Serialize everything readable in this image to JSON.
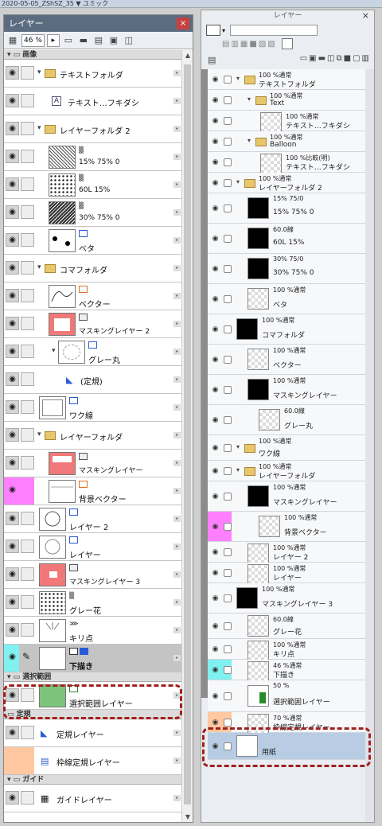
{
  "topbar": {
    "text": "2020-05-05_ZShSZ_35 ▼   ユミック"
  },
  "left": {
    "title": "レイヤー",
    "zoom": "46 %",
    "group_canvas": "画像",
    "group_selection": "選択範囲",
    "group_ruler": "定規",
    "group_guide": "ガイド",
    "rows": [
      {
        "name": "テキストフォルダ",
        "type": "folder"
      },
      {
        "name": "テキスト…フキダシ",
        "type": "text"
      },
      {
        "name": "レイヤーフォルダ 2",
        "type": "folder"
      },
      {
        "name": "15% 75% 0",
        "mode": "▒",
        "type": "tone"
      },
      {
        "name": "60L 15%",
        "mode": "▒",
        "type": "tone2"
      },
      {
        "name": "30% 75% 0",
        "mode": "▒",
        "type": "tone"
      },
      {
        "name": "ベタ",
        "type": "raster"
      },
      {
        "name": "コマフォルダ",
        "type": "folder"
      },
      {
        "name": "ベクター",
        "type": "vector"
      },
      {
        "name": "マスキングレイヤー 2",
        "type": "mask"
      },
      {
        "name": "グレー丸",
        "type": "raster"
      },
      {
        "name": "(定規)",
        "type": "ruler"
      },
      {
        "name": "ワク線",
        "type": "raster"
      },
      {
        "name": "レイヤーフォルダ",
        "type": "folder"
      },
      {
        "name": "マスキングレイヤー",
        "type": "mask"
      },
      {
        "name": "背景ベクター",
        "type": "vector"
      },
      {
        "name": "レイヤー 2",
        "type": "raster"
      },
      {
        "name": "レイヤー",
        "type": "raster"
      },
      {
        "name": "マスキングレイヤー 3",
        "type": "mask"
      },
      {
        "name": "グレー花",
        "type": "raster"
      },
      {
        "name": "キリ点",
        "type": "raster"
      },
      {
        "name": "下描き",
        "type": "draft"
      }
    ],
    "selection_layer": "選択範囲レイヤー",
    "ruler_layer": "定規レイヤー",
    "frame_ruler_layer": "枠線定規レイヤー",
    "guide_layer": "ガイドレイヤー"
  },
  "right": {
    "title": "レイヤー",
    "close": "×",
    "rows": [
      {
        "mode": "100 %通常",
        "name": "テキストフォルダ"
      },
      {
        "mode": "100 %通常",
        "name": "Text"
      },
      {
        "mode": "100 %通常",
        "name": "テキスト…フキダシ"
      },
      {
        "mode": "100 %通常",
        "name": "Balloon"
      },
      {
        "mode": "100 %比較(明)",
        "name": "テキスト…フキダシ"
      },
      {
        "mode": "100 %通常",
        "name": "レイヤーフォルダ 2"
      },
      {
        "mode": "15% 75/0",
        "name": "15% 75% 0"
      },
      {
        "mode": "60.0線",
        "name": "60L 15%"
      },
      {
        "mode": "30% 75/0",
        "name": "30% 75% 0"
      },
      {
        "mode": "100 %通常",
        "name": "ベタ"
      },
      {
        "mode": "100 %通常",
        "name": "コマフォルダ"
      },
      {
        "mode": "100 %通常",
        "name": "ベクター"
      },
      {
        "mode": "100 %通常",
        "name": "マスキングレイヤー"
      },
      {
        "mode": "60.0線",
        "name": "グレー丸"
      },
      {
        "mode": "100 %通常",
        "name": "ワク線"
      },
      {
        "mode": "100 %通常",
        "name": "レイヤーフォルダ"
      },
      {
        "mode": "100 %通常",
        "name": "マスキングレイヤー"
      },
      {
        "mode": "100 %通常",
        "name": "背景ベクター"
      },
      {
        "mode": "100 %通常",
        "name": "レイヤー 2"
      },
      {
        "mode": "100 %通常",
        "name": "レイヤー"
      },
      {
        "mode": "100 %通常",
        "name": "マスキングレイヤー 3"
      },
      {
        "mode": "60.0線",
        "name": "グレー花"
      },
      {
        "mode": "100 %通常",
        "name": "キリ点"
      },
      {
        "mode": "46 %通常",
        "name": "下描き"
      },
      {
        "mode": "50 %",
        "name": "選択範囲レイヤー"
      },
      {
        "mode": "70 %通常",
        "name": "枠線定規レイヤー"
      },
      {
        "mode": "",
        "name": "用紙"
      }
    ]
  },
  "colors": {
    "accent": "#5c6c80",
    "highlight": "#a02020",
    "pink": "#ff80ff",
    "cyan": "#80f0f0",
    "orange": "#ffc8a0"
  }
}
